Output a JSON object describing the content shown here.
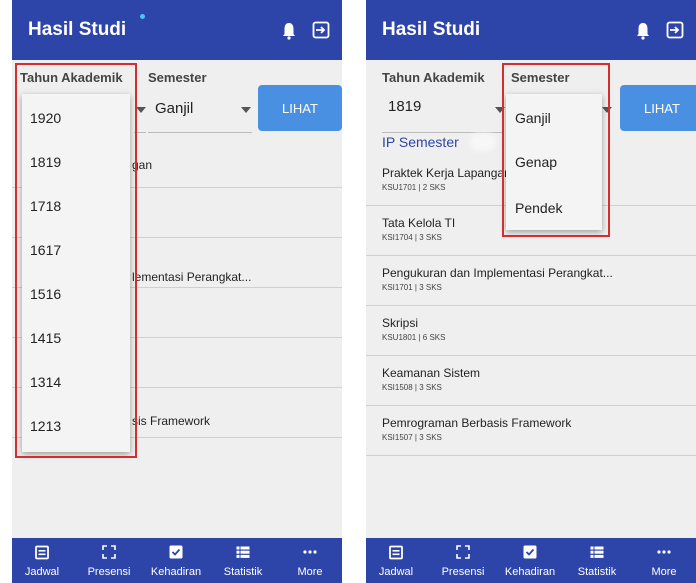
{
  "colors": {
    "app_bar": "#2d45a8",
    "accent": "#4a90e2",
    "highlight": "#d32f2f"
  },
  "app_title": "Hasil Studi",
  "labels": {
    "tahun_akademik": "Tahun Akademik",
    "semester": "Semester",
    "lihat": "LIHAT",
    "ip_semester": "IP Semester"
  },
  "left": {
    "selected_semester": "Ganjil",
    "year_options": [
      "1920",
      "1819",
      "1718",
      "1617",
      "1516",
      "1415",
      "1314",
      "1213"
    ],
    "partial_rows": [
      "gan",
      "lementasi Perangkat...",
      "sis Framework"
    ]
  },
  "right": {
    "selected_year": "1819",
    "semester_options": [
      "Ganjil",
      "Genap",
      "Pendek"
    ],
    "courses": [
      {
        "name": "Praktek Kerja Lapangan",
        "code": "KSU1701 | 2 SKS"
      },
      {
        "name": "Tata Kelola TI",
        "code": "KSI1704 | 3 SKS"
      },
      {
        "name": "Pengukuran dan Implementasi Perangkat...",
        "code": "KSI1701 | 3 SKS"
      },
      {
        "name": "Skripsi",
        "code": "KSU1801 | 6 SKS"
      },
      {
        "name": "Keamanan Sistem",
        "code": "KSI1508 | 3 SKS"
      },
      {
        "name": "Pemrograman Berbasis Framework",
        "code": "KSI1507 | 3 SKS"
      }
    ]
  },
  "nav": [
    {
      "label": "Jadwal",
      "icon": "calendar-icon"
    },
    {
      "label": "Presensi",
      "icon": "scan-icon"
    },
    {
      "label": "Kehadiran",
      "icon": "checkbox-icon"
    },
    {
      "label": "Statistik",
      "icon": "list-icon"
    },
    {
      "label": "More",
      "icon": "more-icon"
    }
  ]
}
